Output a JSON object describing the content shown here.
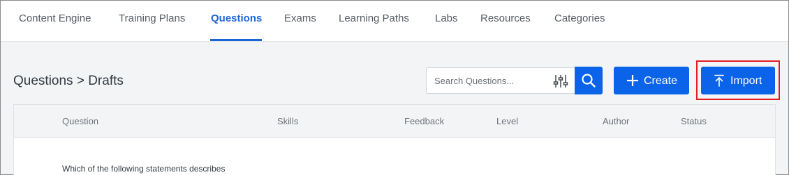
{
  "nav": {
    "tabs": [
      {
        "label": "Content Engine"
      },
      {
        "label": "Training Plans"
      },
      {
        "label": "Questions",
        "active": true
      },
      {
        "label": "Exams"
      },
      {
        "label": "Learning Paths"
      },
      {
        "label": "Labs"
      },
      {
        "label": "Resources"
      },
      {
        "label": "Categories"
      }
    ]
  },
  "page": {
    "title": "Questions > Drafts"
  },
  "search": {
    "placeholder": "Search Questions..."
  },
  "actions": {
    "create_label": "Create",
    "import_label": "Import"
  },
  "table": {
    "columns": [
      "Question",
      "Skills",
      "Feedback",
      "Level",
      "Author",
      "Status"
    ],
    "rows": [
      {
        "question": "Which of the following statements describes"
      }
    ]
  },
  "icons": {
    "filter": "sliders-icon",
    "search": "search-icon",
    "create": "plus-icon",
    "import": "upload-icon"
  },
  "colors": {
    "accent": "#1a66d9",
    "primary_button": "#0a63e8",
    "highlight_outline": "#e31b23"
  }
}
